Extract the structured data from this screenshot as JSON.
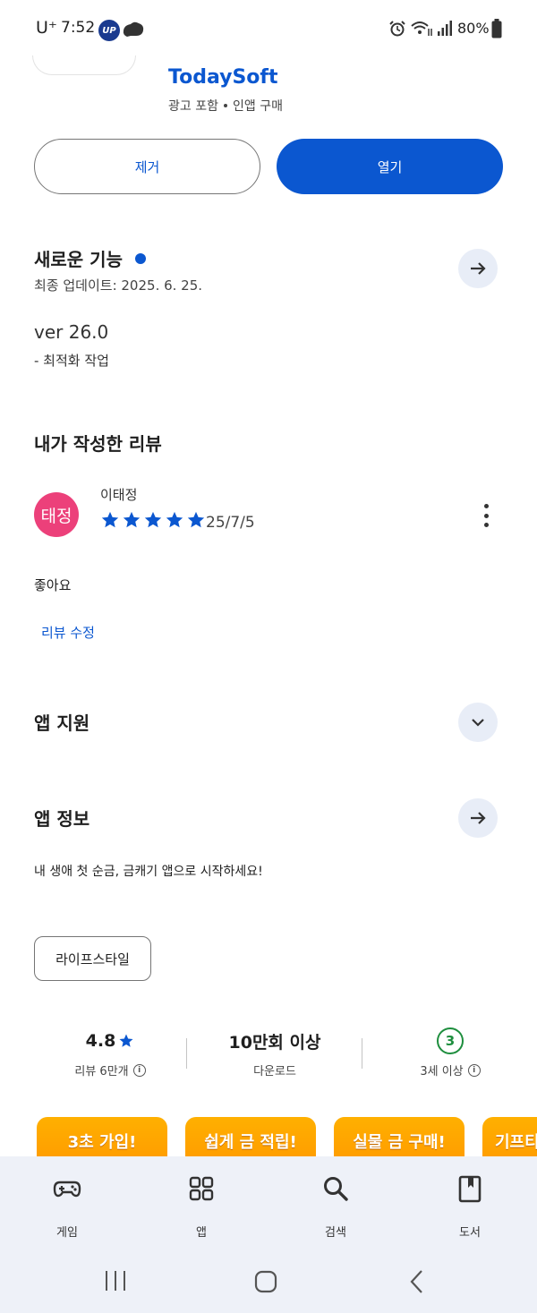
{
  "status_bar": {
    "carrier": "U⁺",
    "time": "7:52",
    "carrier_badge": "UP",
    "battery": "80%"
  },
  "app": {
    "developer": "TodaySoft",
    "meta_ads": "광고 포함",
    "meta_iap": "인앱 구매"
  },
  "actions": {
    "uninstall_label": "제거",
    "open_label": "열기"
  },
  "whats_new": {
    "title": "새로운 기능",
    "updated": "최종 업데이트: 2025. 6. 25.",
    "version": "ver 26.0",
    "notes": "- 최적화 작업"
  },
  "my_review": {
    "title": "내가 작성한 리뷰",
    "avatar_text": "태정",
    "author": "이태정",
    "rating": 5,
    "date": "25/7/5",
    "text": "좋아요",
    "edit_label": "리뷰 수정"
  },
  "app_support": {
    "title": "앱 지원"
  },
  "app_info": {
    "title": "앱 정보",
    "description": "내 생애 첫 순금, 금캐기 앱으로 시작하세요!",
    "category": "라이프스타일"
  },
  "stats": {
    "rating": "4.8",
    "reviews_label": "리뷰 6만개",
    "downloads": "10만회 이상",
    "downloads_label": "다운로드",
    "age_rating": "3",
    "age_label": "3세 이상"
  },
  "promos": [
    "3초 가입!",
    "쉽게 금 적립!",
    "실물 금 구매!",
    "기프티"
  ],
  "bottom_nav": {
    "games": "게임",
    "apps": "앱",
    "search": "검색",
    "books": "도서"
  },
  "colors": {
    "accent": "#0b57d0",
    "avatar": "#ec407a",
    "promo": "#ffa000",
    "age_badge": "#1e8e3e"
  }
}
